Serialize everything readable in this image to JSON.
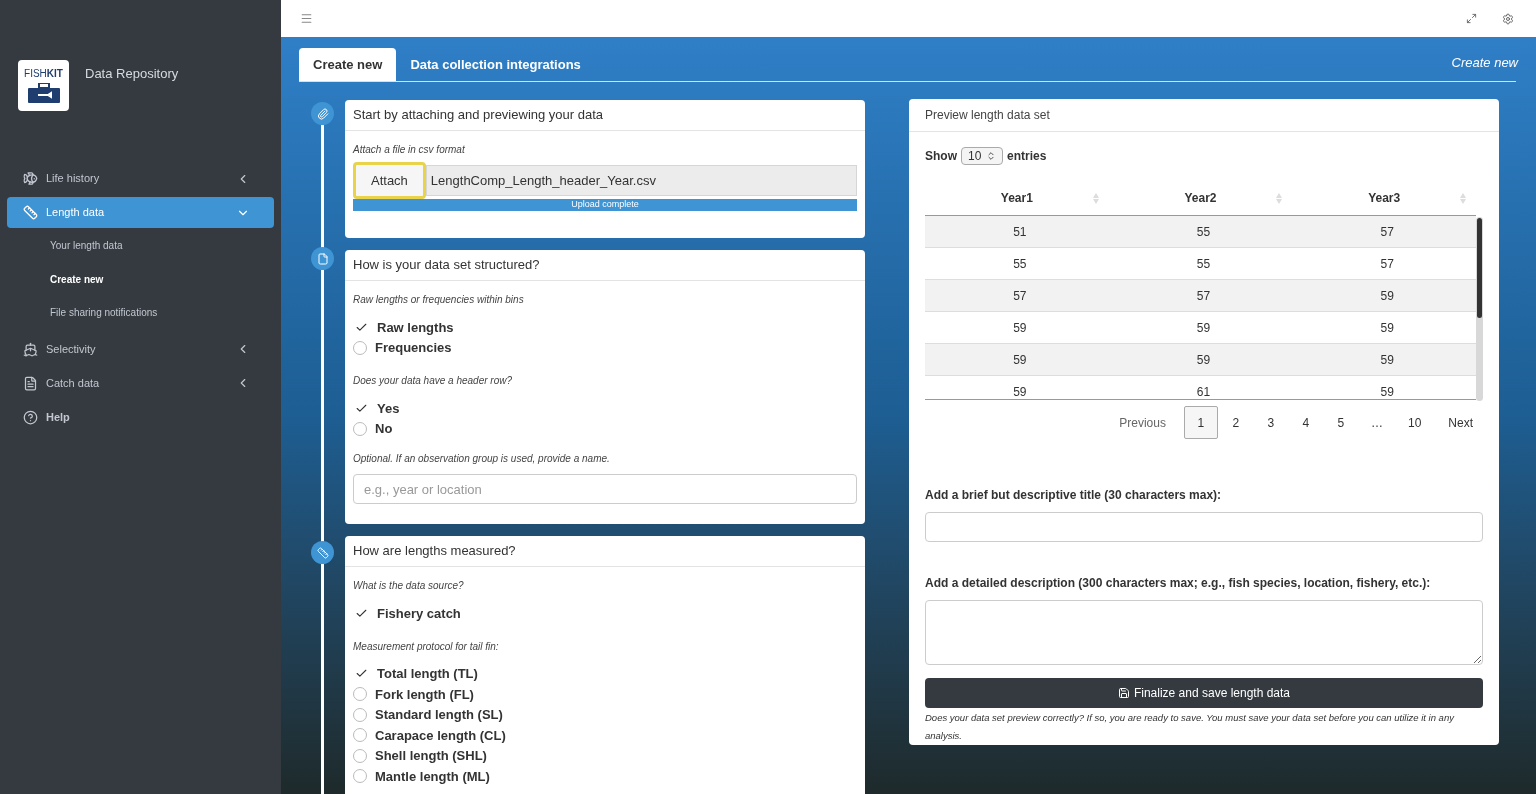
{
  "sidebar": {
    "logo": "FISH**KIT**",
    "title": "Data Repository",
    "items": [
      {
        "label": "Life history",
        "kind": "menu",
        "selected": false,
        "expanded": false
      },
      {
        "label": "Length data",
        "kind": "menu",
        "selected": true,
        "expanded": true,
        "children": [
          {
            "label": "Your length data",
            "selected": false
          },
          {
            "label": "Create new",
            "selected": true
          },
          {
            "label": "File sharing notifications",
            "selected": false
          }
        ]
      },
      {
        "label": "Selectivity",
        "kind": "menu",
        "selected": false,
        "expanded": false
      },
      {
        "label": "Catch data",
        "kind": "menu",
        "selected": false,
        "expanded": false
      },
      {
        "label": "Help",
        "kind": "link",
        "selected": false
      }
    ]
  },
  "tabs": [
    {
      "label": "Create new",
      "selected": true
    },
    {
      "label": "Data collection integrations",
      "selected": false
    }
  ],
  "breadcrumb": "Create new",
  "attach_card": {
    "title": "Start by attaching and previewing your data",
    "hint": "Attach a file in csv format",
    "button": "Attach",
    "highlighted": true,
    "file": "LengthComp_Length_header_Year.csv",
    "level": 1,
    "status": "Upload complete"
  },
  "structure_card": {
    "title": "How is your data set structured?",
    "groups": [
      {
        "question": "Raw lengths or frequencies within bins",
        "options": [
          {
            "label": "Raw lengths",
            "selected": true
          },
          {
            "label": "Frequencies",
            "selected": false
          }
        ]
      },
      {
        "question": "Does your data have a header row?",
        "options": [
          {
            "label": "Yes",
            "selected": true
          },
          {
            "label": "No",
            "selected": false
          }
        ]
      }
    ],
    "optional_label": "Optional. If an observation group is used, provide a name.",
    "placeholder": "e.g., year or location"
  },
  "measure_card": {
    "title": "How are lengths measured?",
    "groups": [
      {
        "question": "What is the data source?",
        "options": [
          {
            "label": "Fishery catch",
            "selected": true
          }
        ]
      },
      {
        "question": "Measurement protocol for tail fin:",
        "options": [
          {
            "label": "Total length (TL)",
            "selected": true
          },
          {
            "label": "Fork length (FL)",
            "selected": false
          },
          {
            "label": "Standard length (SL)",
            "selected": false
          },
          {
            "label": "Carapace length (CL)",
            "selected": false
          },
          {
            "label": "Shell length (SHL)",
            "selected": false
          },
          {
            "label": "Mantle length (ML)",
            "selected": false
          }
        ]
      }
    ]
  },
  "preview": {
    "title": "Preview length data set",
    "show": "Show",
    "page_size": "10",
    "entries": "entries",
    "columns": [
      "Year1",
      "Year2",
      "Year3"
    ],
    "rows": [
      [
        "51",
        "55",
        "57"
      ],
      [
        "55",
        "55",
        "57"
      ],
      [
        "57",
        "57",
        "59"
      ],
      [
        "59",
        "59",
        "59"
      ],
      [
        "59",
        "59",
        "59"
      ],
      [
        "59",
        "61",
        "59"
      ]
    ],
    "previous": "Previous",
    "pages": [
      {
        "label": "1",
        "selected": true
      },
      {
        "label": "2",
        "selected": false
      },
      {
        "label": "3",
        "selected": false
      },
      {
        "label": "4",
        "selected": false
      },
      {
        "label": "5",
        "selected": false
      },
      {
        "label": "…",
        "selected": false
      },
      {
        "label": "10",
        "selected": false
      }
    ],
    "next": "Next",
    "title_label": "Add a brief but descriptive title (30 characters max):",
    "description_label": "Add a detailed description (300 characters max; e.g., fish species, location, fishery, etc.):",
    "save_button": "Finalize and save length data",
    "note": "Does your data set preview correctly? If so, you are ready to save. You must save your data set before you can utilize it in any analysis."
  }
}
